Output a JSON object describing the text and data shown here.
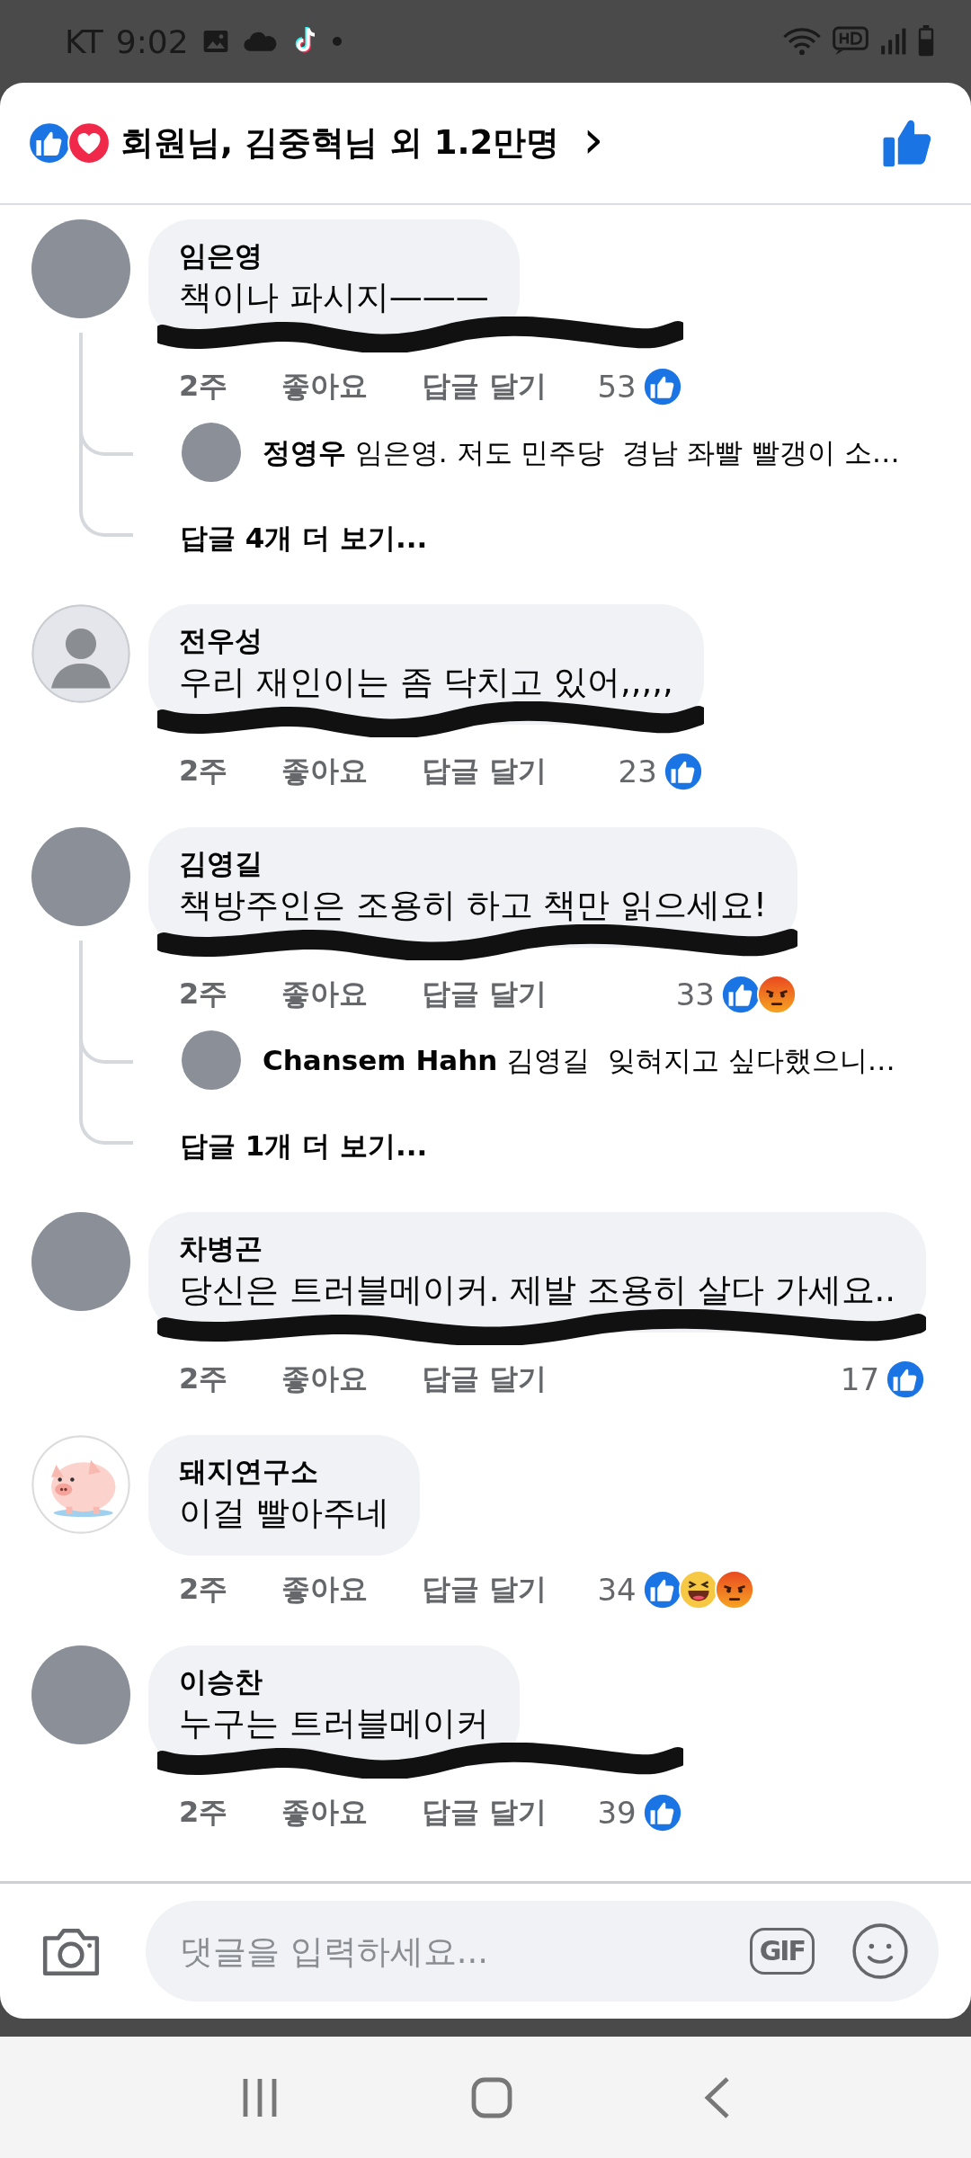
{
  "status_bar": {
    "carrier": "KT",
    "time": "9:02"
  },
  "header": {
    "title": "회원님, 김중혁님 외 1.2만명",
    "chevron": "›"
  },
  "comments": [
    {
      "author": "임은영",
      "text": "책이나 파시지———",
      "avatar": {
        "kind": "photo"
      },
      "scribbled": true,
      "time": "2주",
      "like_action": "좋아요",
      "reply_action": "답글 달기",
      "count": "53",
      "reactions": [
        {
          "kind": "like"
        }
      ],
      "replies": [
        {
          "author": "정영우",
          "text": "임은영. 저도 민주당  경남 좌빨 빨갱이 소…",
          "avatar": {
            "kind": "photo"
          }
        }
      ],
      "more_replies": "답글 4개 더 보기..."
    },
    {
      "author": "전우성",
      "text": "우리 재인이는 좀 닥치고 있어,,,,,",
      "avatar": {
        "kind": "silhouette"
      },
      "scribbled": true,
      "time": "2주",
      "like_action": "좋아요",
      "reply_action": "답글 달기",
      "count": "23",
      "reactions": [
        {
          "kind": "like"
        }
      ]
    },
    {
      "author": "김영길",
      "text": "책방주인은 조용히 하고 책만 읽으세요!",
      "avatar": {
        "kind": "photo"
      },
      "scribbled": true,
      "time": "2주",
      "like_action": "좋아요",
      "reply_action": "답글 달기",
      "count": "33",
      "reactions": [
        {
          "kind": "like"
        },
        {
          "kind": "angry"
        }
      ],
      "replies": [
        {
          "author": "Chansem Hahn",
          "text": "김영길  잊혀지고 싶다했으니…",
          "avatar": {
            "kind": "photo"
          }
        }
      ],
      "more_replies": "답글 1개 더 보기..."
    },
    {
      "author": "차병곤",
      "text": "당신은 트러블메이커. 제발 조용히 살다 가세요..",
      "avatar": {
        "kind": "photo"
      },
      "scribbled": true,
      "time": "2주",
      "like_action": "좋아요",
      "reply_action": "답글 달기",
      "count": "17",
      "reactions": [
        {
          "kind": "like"
        }
      ]
    },
    {
      "author": "돼지연구소",
      "text": "이걸 빨아주네",
      "avatar": {
        "kind": "pig"
      },
      "scribbled": false,
      "time": "2주",
      "like_action": "좋아요",
      "reply_action": "답글 달기",
      "count": "34",
      "reactions": [
        {
          "kind": "like"
        },
        {
          "kind": "haha"
        },
        {
          "kind": "angry"
        }
      ]
    },
    {
      "author": "이승찬",
      "text": "누구는 트러블메이커",
      "avatar": {
        "kind": "photo"
      },
      "scribbled": true,
      "time": "2주",
      "like_action": "좋아요",
      "reply_action": "답글 달기",
      "count": "39",
      "reactions": [
        {
          "kind": "like"
        }
      ]
    }
  ],
  "composer": {
    "placeholder": "댓글을 입력하세요...",
    "gif_label": "GIF"
  }
}
